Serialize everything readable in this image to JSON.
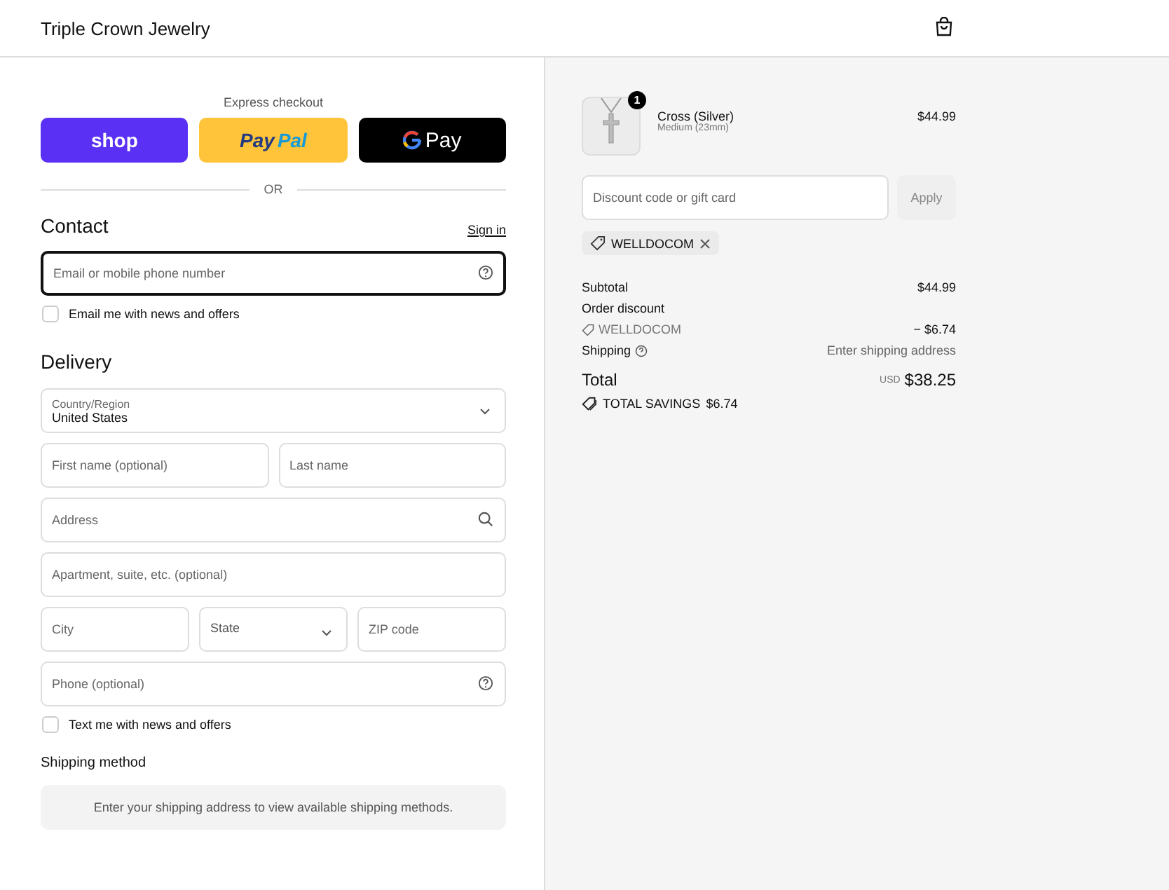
{
  "header": {
    "store_name": "Triple Crown Jewelry"
  },
  "express": {
    "title": "Express checkout",
    "buttons": [
      {
        "kind": "shop",
        "label": "shop"
      },
      {
        "kind": "paypal",
        "label": "Pay",
        "label_2": "Pal"
      },
      {
        "kind": "gpay",
        "label": "Pay"
      }
    ],
    "separator": "OR"
  },
  "contact": {
    "heading": "Contact",
    "sign_in": "Sign in",
    "email": {
      "placeholder": "Email or mobile phone number"
    },
    "news": {
      "label": "Email me with news and offers",
      "checked": false
    }
  },
  "delivery": {
    "heading": "Delivery",
    "country": {
      "label": "Country/Region",
      "value": "United States"
    },
    "fields": [
      {
        "placeholder": "First name (optional)"
      },
      {
        "placeholder": "Last name"
      }
    ],
    "address": {
      "placeholder": "Address"
    },
    "apartment": {
      "placeholder": "Apartment, suite, etc. (optional)"
    },
    "city": {
      "placeholder": "City"
    },
    "state": {
      "placeholder": "State"
    },
    "zip": {
      "placeholder": "ZIP code"
    },
    "phone": {
      "placeholder": "Phone (optional)"
    },
    "text_news": {
      "label": "Text me with news and offers",
      "checked": false
    }
  },
  "shipping_method": {
    "heading": "Shipping method",
    "notice": "Enter your shipping address to view available shipping methods."
  },
  "summary": {
    "item": {
      "name": "Cross (Silver)",
      "variant": "Medium (23mm)",
      "price": "$44.99",
      "quantity": "1"
    },
    "discount": {
      "placeholder": "Discount code or gift card",
      "apply": "Apply",
      "applied_code": "WELLDOCOM"
    },
    "subtotal_label": "Subtotal",
    "subtotal": "$44.99",
    "order_discount_label": "Order discount",
    "discount_code": "WELLDOCOM",
    "discount_amount": "− $6.74",
    "shipping_label": "Shipping",
    "shipping_value": "Enter shipping address",
    "total_label": "Total",
    "currency": "USD",
    "total": "$38.25",
    "savings_label": "TOTAL SAVINGS",
    "savings": "$6.74"
  }
}
